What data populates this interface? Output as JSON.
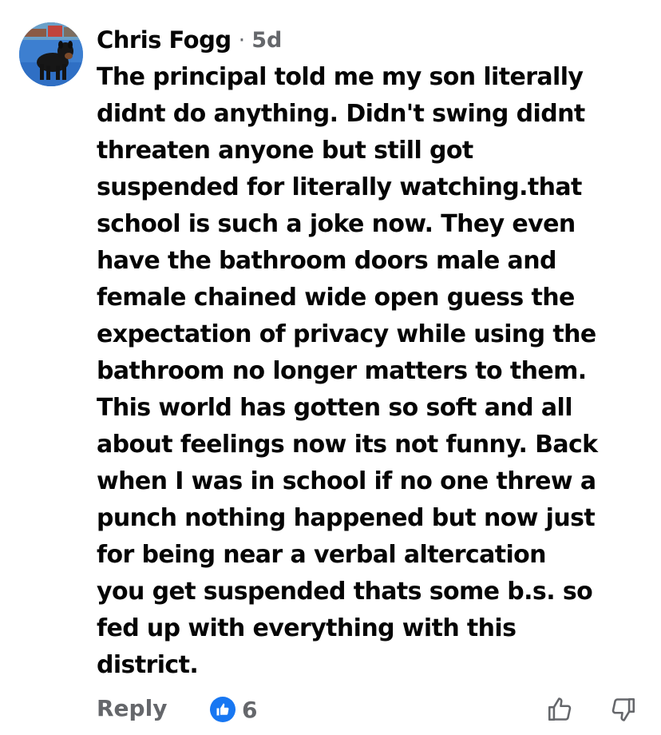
{
  "comment": {
    "author": "Chris Fogg",
    "separator": "·",
    "time": "5d",
    "text": "The principal told me my son literally\ndidnt do anything. Didn't swing didnt\nthreaten anyone but still got\nsuspended for literally watching.that\nschool is such a joke now. They even\nhave the bathroom doors male and\nfemale chained wide open guess the\nexpectation of privacy while using the\nbathroom no longer matters to them.\nThis world has gotten so soft and all\nabout feelings now its not funny. Back\nwhen I was in school if no one threw a\npunch nothing happened but now just\nfor being near  a verbal altercation\nyou get suspended thats some b.s. so\nfed up with everything with this\ndistrict.",
    "reply_label": "Reply",
    "reaction_count": "6",
    "reaction_icon": "like-icon",
    "upvote_icon": "thumbs-up-outline-icon",
    "downvote_icon": "thumbs-down-outline-icon"
  },
  "colors": {
    "text": "#050505",
    "secondary": "#65676b",
    "like_blue": "#1877f2"
  }
}
